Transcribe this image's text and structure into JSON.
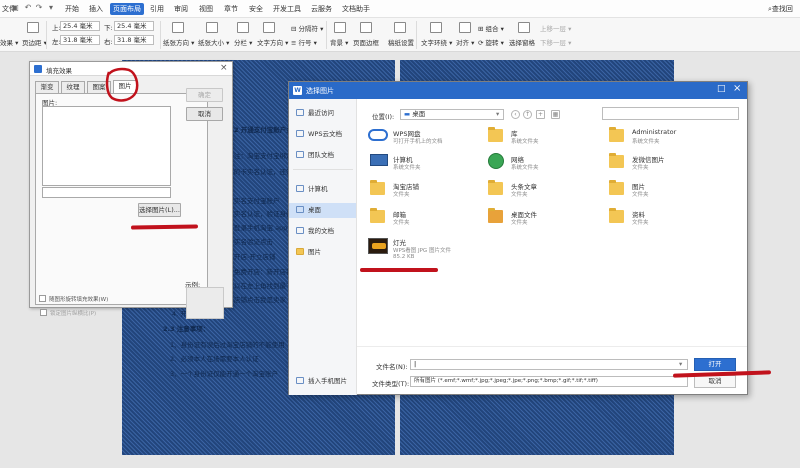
{
  "menu": {
    "file_label": "文件",
    "tabs": [
      "开始",
      "插入",
      "页面布局",
      "引用",
      "审阅",
      "视图",
      "章节",
      "安全",
      "开发工具",
      "云服务",
      "文档助手"
    ],
    "active_tab": "页面布局",
    "search_label": "查找回"
  },
  "toolbar": {
    "effect": "效果",
    "margins": "页边距",
    "top_label": "上:",
    "top_value": "25.4 毫米",
    "bottom_label": "下:",
    "bottom_value": "25.4 毫米",
    "left_label": "左:",
    "left_value": "31.8 毫米",
    "right_label": "右:",
    "right_value": "31.8 毫米",
    "orientation": "纸张方向",
    "size": "纸张大小",
    "columns": "分栏",
    "text_direction": "文字方向",
    "separator": "分隔符",
    "line_numbers": "行号",
    "background": "背景",
    "page_border": "页面边框",
    "draft_settings": "稿纸设置",
    "text_wrap": "文字环绕",
    "align": "对齐",
    "group": "组合",
    "rotate": "旋转",
    "selection_pane": "选择窗格",
    "bring_forward": "上移一层",
    "send_backward": "下移一层"
  },
  "document": {
    "lines": [
      "2 开通支付宝账户并完善个",
      "注：淘宝支付宝绑定的卡，须是本",
      "的卡实名认证，还需要同意注",
      "  实名支付宝账户",
      "  实名认证，验证身份证",
      "  登录手机淘宝 app 完成",
      "  实名验证点击",
      "  开店-开立店铺",
      "  免费开店：新开店铺",
      "  以在左上角找到最下载",
      "  店铺点击我是卖家",
      "  4. 开通店铺",
      "2.3 注意事项：",
      "1、身份证有误后过淘宝店铺的不能使用",
      "2、必须本人在场需要本人认证",
      "3、一个身份证仅能开通一个淘宝账户"
    ]
  },
  "fill_dialog": {
    "title": "填充效果",
    "tabs": [
      "渐变",
      "纹理",
      "图案",
      "图片"
    ],
    "active_tab": "图片",
    "picture_label": "图片:",
    "select_button": "选择图片(L)...",
    "ok_button": "确定",
    "cancel_button": "取消",
    "sample_label": "示例:",
    "lock_aspect": "锁定图片纵横比(P)",
    "rotate_with_shape": "随图形旋转填充效果(W)"
  },
  "select_dialog": {
    "title": "选择图片",
    "sidebar": [
      {
        "label": "最近访问",
        "icon": "clock-icon"
      },
      {
        "label": "WPS云文档",
        "icon": "cloud-icon"
      },
      {
        "label": "团队文档",
        "icon": "team-icon"
      },
      {
        "label": "计算机",
        "icon": "computer-icon"
      },
      {
        "label": "桌面",
        "icon": "desktop-icon"
      },
      {
        "label": "我的文档",
        "icon": "documents-icon"
      },
      {
        "label": "图片",
        "icon": "pictures-icon"
      }
    ],
    "active_sidebar": "桌面",
    "location_label": "位置(I):",
    "location_value": "桌面",
    "files": [
      {
        "name": "WPS网盘",
        "sub": "可打开手机上的文档",
        "icon": "cloud-drive-icon"
      },
      {
        "name": "库",
        "sub": "系统文件夹",
        "icon": "library-icon"
      },
      {
        "name": "Administrator",
        "sub": "系统文件夹",
        "icon": "user-folder-icon"
      },
      {
        "name": "计算机",
        "sub": "系统文件夹",
        "icon": "computer-icon"
      },
      {
        "name": "网络",
        "sub": "系统文件夹",
        "icon": "network-icon"
      },
      {
        "name": "发微信图片",
        "sub": "文件夹",
        "icon": "folder-icon"
      },
      {
        "name": "淘宝店铺",
        "sub": "文件夹",
        "icon": "folder-icon"
      },
      {
        "name": "头条文章",
        "sub": "文件夹",
        "icon": "folder-icon"
      },
      {
        "name": "图片",
        "sub": "文件夹",
        "icon": "folder-icon"
      },
      {
        "name": "邮箱",
        "sub": "文件夹",
        "icon": "folder-icon"
      },
      {
        "name": "桌面文件",
        "sub": "文件夹",
        "icon": "folder-icon"
      },
      {
        "name": "资料",
        "sub": "文件夹",
        "icon": "folder-icon"
      },
      {
        "name": "灯光",
        "sub": "WPS看图 JPG 图片文件",
        "size": "85.2 KB",
        "icon": "image-file-icon"
      }
    ],
    "filename_label": "文件名(N):",
    "filename_value": "",
    "filetype_label": "文件类型(T):",
    "filetype_value": "所有图片 (*.emf;*.wmf;*.jpg;*.jpeg;*.jpe;*.png;*.bmp;*.gif;*.tif;*.tiff)",
    "open_button": "打开",
    "cancel_button": "取消",
    "phone_import": "插入手机图片"
  },
  "colors": {
    "accent": "#2d6fd0",
    "page_fill": "#2b4f88",
    "annotation": "#c1121c"
  }
}
